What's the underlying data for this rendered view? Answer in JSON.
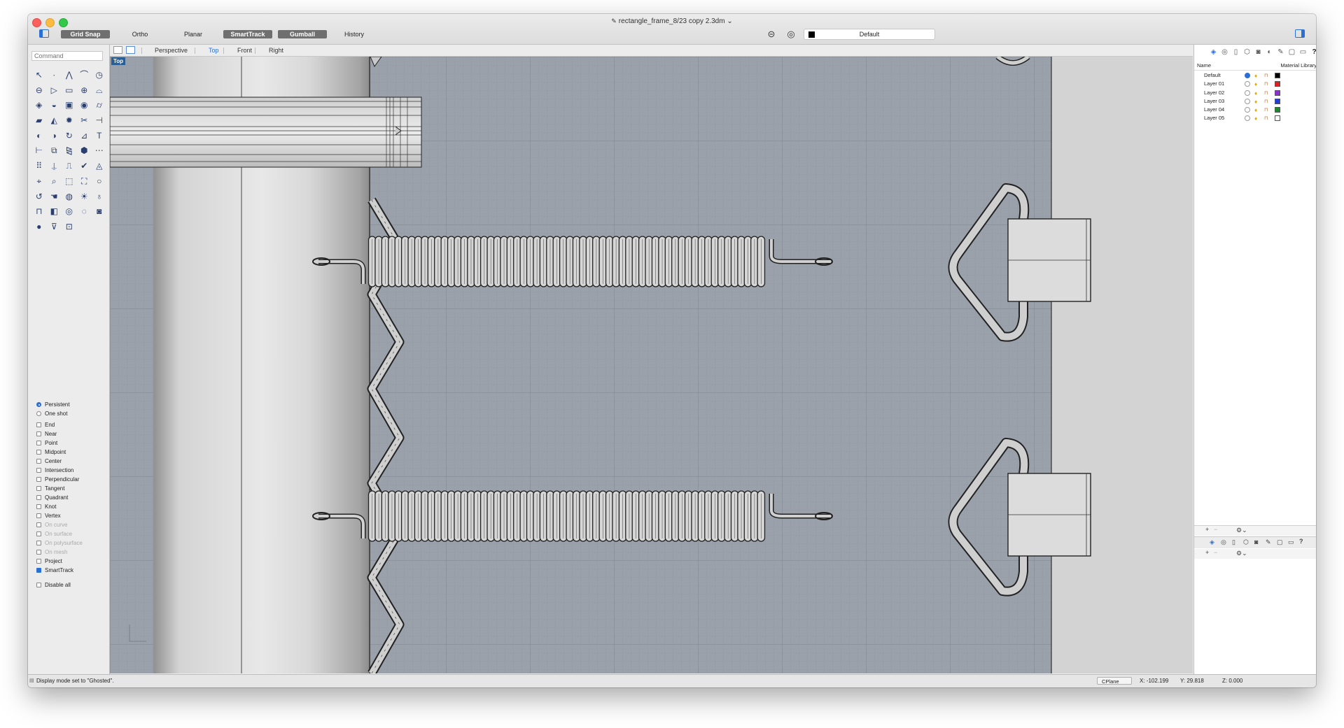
{
  "window": {
    "title": "rectangle_frame_8/23 copy 2.3dm",
    "title_chevron": "⌄"
  },
  "toolbar": {
    "grid_snap": "Grid Snap",
    "ortho": "Ortho",
    "planar": "Planar",
    "smarttrack": "SmartTrack",
    "gumball": "Gumball",
    "history": "History",
    "current_layer": "Default",
    "current_layer_color": "#000000"
  },
  "command": {
    "placeholder": "Command"
  },
  "viewport_tabs": [
    "Perspective",
    "Top",
    "Front",
    "Right"
  ],
  "active_view": "Top",
  "viewport": {
    "label": "Top",
    "display_mode": "Ghosted"
  },
  "osnaps": [
    {
      "label": "Persistent",
      "type": "radio",
      "checked": true,
      "enabled": true
    },
    {
      "label": "One shot",
      "type": "radio",
      "checked": false,
      "enabled": true
    },
    {
      "label": "End",
      "type": "check",
      "checked": false,
      "enabled": true
    },
    {
      "label": "Near",
      "type": "check",
      "checked": false,
      "enabled": true
    },
    {
      "label": "Point",
      "type": "check",
      "checked": false,
      "enabled": true
    },
    {
      "label": "Midpoint",
      "type": "check",
      "checked": false,
      "enabled": true
    },
    {
      "label": "Center",
      "type": "check",
      "checked": false,
      "enabled": true
    },
    {
      "label": "Intersection",
      "type": "check",
      "checked": false,
      "enabled": true
    },
    {
      "label": "Perpendicular",
      "type": "check",
      "checked": false,
      "enabled": true
    },
    {
      "label": "Tangent",
      "type": "check",
      "checked": false,
      "enabled": true
    },
    {
      "label": "Quadrant",
      "type": "check",
      "checked": false,
      "enabled": true
    },
    {
      "label": "Knot",
      "type": "check",
      "checked": false,
      "enabled": true
    },
    {
      "label": "Vertex",
      "type": "check",
      "checked": false,
      "enabled": true
    },
    {
      "label": "On curve",
      "type": "check",
      "checked": false,
      "enabled": false
    },
    {
      "label": "On surface",
      "type": "check",
      "checked": false,
      "enabled": false
    },
    {
      "label": "On polysurface",
      "type": "check",
      "checked": false,
      "enabled": false
    },
    {
      "label": "On mesh",
      "type": "check",
      "checked": false,
      "enabled": false
    },
    {
      "label": "Project",
      "type": "check",
      "checked": false,
      "enabled": true
    },
    {
      "label": "SmartTrack",
      "type": "check",
      "checked": true,
      "enabled": true
    },
    {
      "label": "Disable all",
      "type": "check",
      "checked": false,
      "enabled": true,
      "gap_before": true
    }
  ],
  "layers_panel": {
    "name_header": "Name",
    "material_header": "Material Library",
    "layers": [
      {
        "name": "Default",
        "current": true,
        "color": "#000000"
      },
      {
        "name": "Layer 01",
        "current": false,
        "color": "#e02020"
      },
      {
        "name": "Layer 02",
        "current": false,
        "color": "#8e2fd0"
      },
      {
        "name": "Layer 03",
        "current": false,
        "color": "#1f3fd8"
      },
      {
        "name": "Layer 04",
        "current": false,
        "color": "#1c8a2c"
      },
      {
        "name": "Layer 05",
        "current": false,
        "color": "#ffffff"
      }
    ]
  },
  "status": {
    "message": "Display mode set to \"Ghosted\".",
    "cplane": "CPlane",
    "x": "X: -102.199",
    "y": "Y: 29.818",
    "z": "Z: 0.000"
  }
}
